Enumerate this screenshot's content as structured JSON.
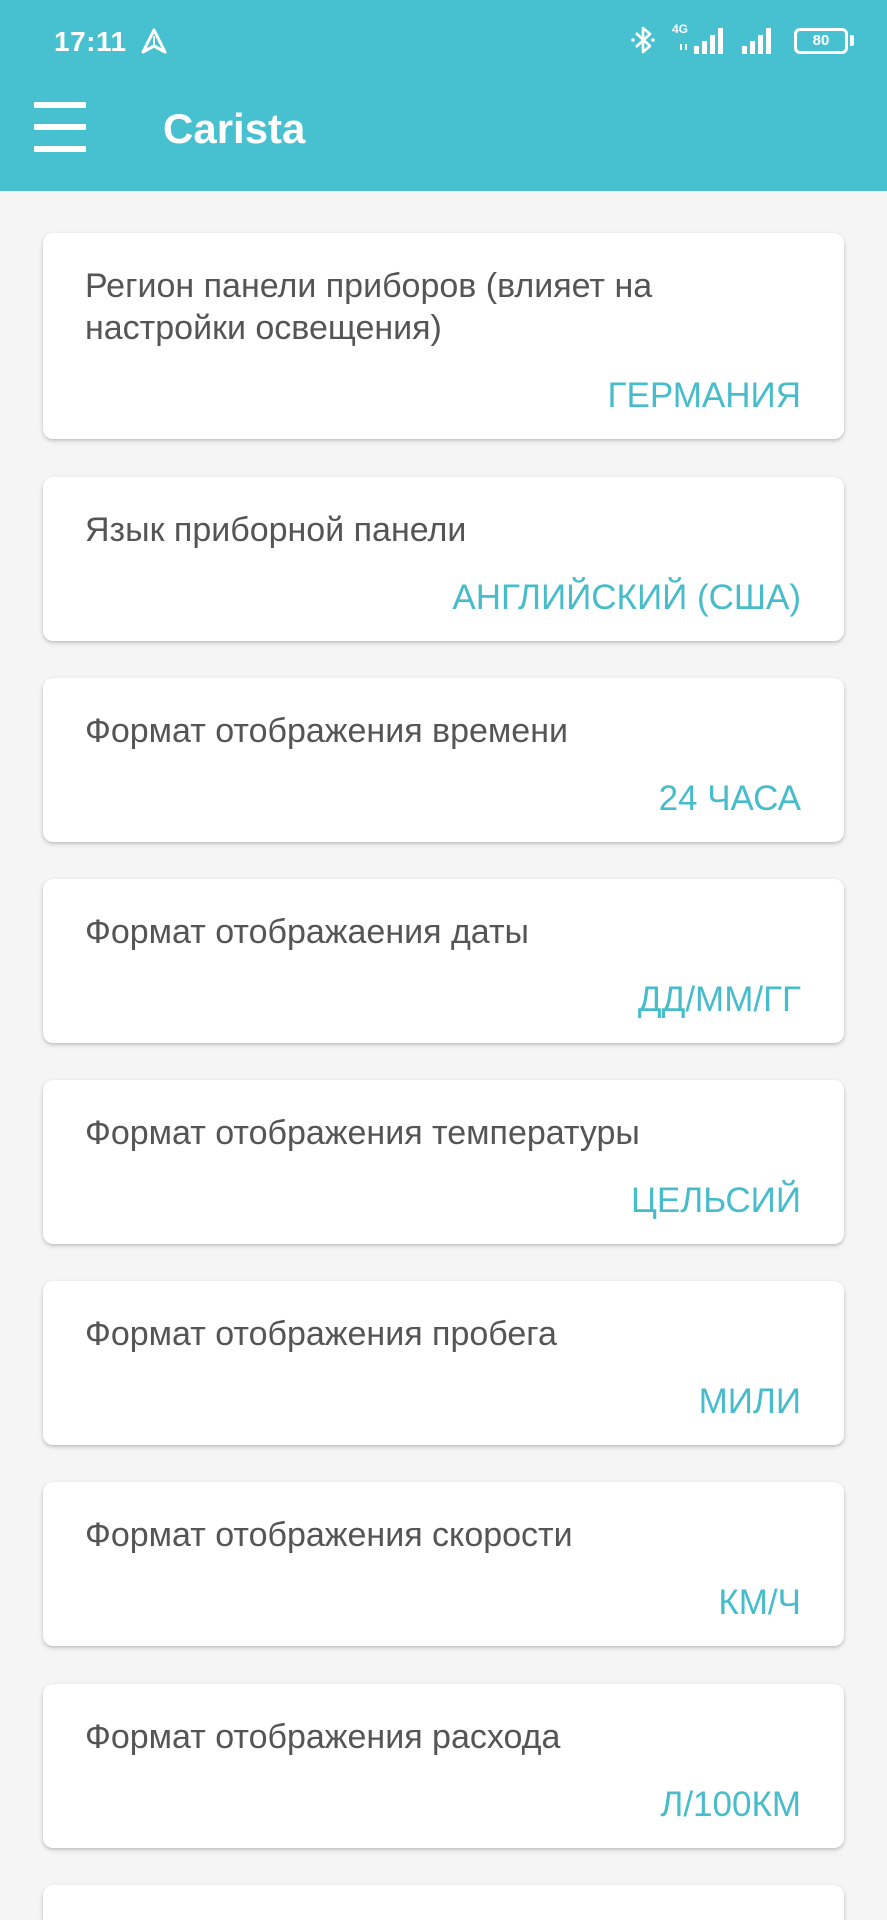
{
  "status_bar": {
    "time": "17:11",
    "network_label": "4G",
    "battery": "80",
    "icons": [
      "navigation-icon",
      "bluetooth-icon",
      "signal-icon",
      "battery-icon"
    ]
  },
  "app_bar": {
    "title": "Carista",
    "color": "#47c1d0"
  },
  "accent_color": "#47bccb",
  "settings": [
    {
      "label": "Регион панели приборов (влияет на настройки освещения)",
      "value": "ГЕРМАНИЯ"
    },
    {
      "label": "Язык приборной панели",
      "value": "АНГЛИЙСКИЙ (США)"
    },
    {
      "label": "Формат отображения времени",
      "value": "24 ЧАСА"
    },
    {
      "label": "Формат отображаения даты",
      "value": "ДД/ММ/ГГ"
    },
    {
      "label": "Формат отображения температуры",
      "value": "ЦЕЛЬСИЙ"
    },
    {
      "label": "Формат отображения пробега",
      "value": "МИЛИ"
    },
    {
      "label": "Формат отображения скорости",
      "value": "КМ/Ч"
    },
    {
      "label": "Формат отображения расхода",
      "value": "Л/100КМ"
    }
  ]
}
